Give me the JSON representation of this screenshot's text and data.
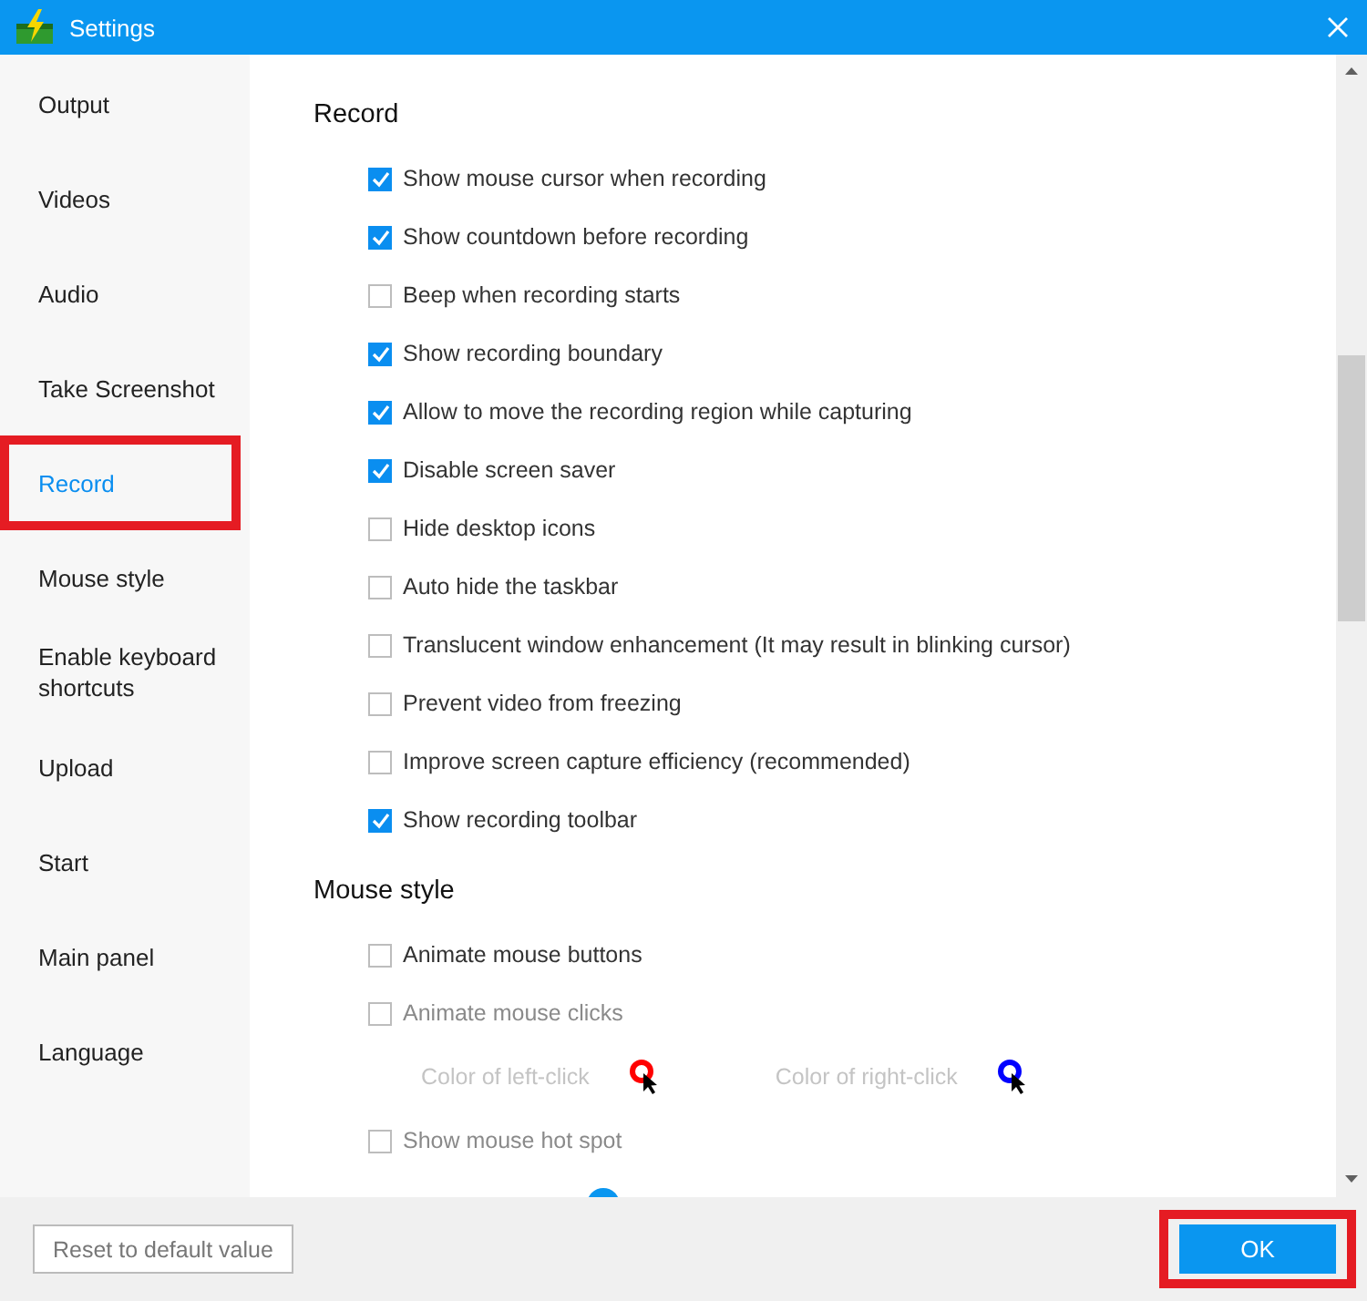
{
  "window": {
    "title": "Settings"
  },
  "sidebar": {
    "items": [
      {
        "label": "Output",
        "selected": false,
        "highlighted": false
      },
      {
        "label": "Videos",
        "selected": false,
        "highlighted": false
      },
      {
        "label": "Audio",
        "selected": false,
        "highlighted": false
      },
      {
        "label": "Take Screenshot",
        "selected": false,
        "highlighted": false
      },
      {
        "label": "Record",
        "selected": true,
        "highlighted": true
      },
      {
        "label": "Mouse style",
        "selected": false,
        "highlighted": false
      },
      {
        "label": "Enable keyboard shortcuts",
        "selected": false,
        "highlighted": false
      },
      {
        "label": "Upload",
        "selected": false,
        "highlighted": false
      },
      {
        "label": "Start",
        "selected": false,
        "highlighted": false
      },
      {
        "label": "Main panel",
        "selected": false,
        "highlighted": false
      },
      {
        "label": "Language",
        "selected": false,
        "highlighted": false
      }
    ]
  },
  "sections": [
    {
      "title": "Record",
      "items": [
        {
          "kind": "checkbox",
          "label": "Show mouse cursor when recording",
          "checked": true,
          "disabled": false
        },
        {
          "kind": "checkbox",
          "label": "Show countdown before recording",
          "checked": true,
          "disabled": false
        },
        {
          "kind": "checkbox",
          "label": "Beep when recording starts",
          "checked": false,
          "disabled": false
        },
        {
          "kind": "checkbox",
          "label": "Show recording boundary",
          "checked": true,
          "disabled": false
        },
        {
          "kind": "checkbox",
          "label": "Allow to move the recording region while capturing",
          "checked": true,
          "disabled": false
        },
        {
          "kind": "checkbox",
          "label": "Disable screen saver",
          "checked": true,
          "disabled": false
        },
        {
          "kind": "checkbox",
          "label": "Hide desktop icons",
          "checked": false,
          "disabled": false
        },
        {
          "kind": "checkbox",
          "label": "Auto hide the taskbar",
          "checked": false,
          "disabled": false
        },
        {
          "kind": "checkbox",
          "label": "Translucent window enhancement (It may result in blinking cursor)",
          "checked": false,
          "disabled": false
        },
        {
          "kind": "checkbox",
          "label": "Prevent video from freezing",
          "checked": false,
          "disabled": false
        },
        {
          "kind": "checkbox",
          "label": "Improve screen capture efficiency (recommended)",
          "checked": false,
          "disabled": false
        },
        {
          "kind": "checkbox",
          "label": "Show recording toolbar",
          "checked": true,
          "disabled": false
        }
      ]
    },
    {
      "title": "Mouse style",
      "items": [
        {
          "kind": "checkbox",
          "label": "Animate mouse buttons",
          "checked": false,
          "disabled": false
        },
        {
          "kind": "checkbox",
          "label": "Animate mouse clicks",
          "checked": false,
          "disabled": true
        },
        {
          "kind": "colors",
          "disabled": true,
          "pickers": [
            {
              "label": "Color of left-click",
              "color": "#ff0000"
            },
            {
              "label": "Color of right-click",
              "color": "#0000ff"
            }
          ]
        },
        {
          "kind": "checkbox",
          "label": "Show mouse hot spot",
          "checked": false,
          "disabled": true
        },
        {
          "kind": "swatch",
          "color": "#0a96f0"
        }
      ]
    }
  ],
  "footer": {
    "reset_button": "Reset to default value",
    "ok_button": {
      "label": "OK",
      "highlighted": true
    }
  }
}
